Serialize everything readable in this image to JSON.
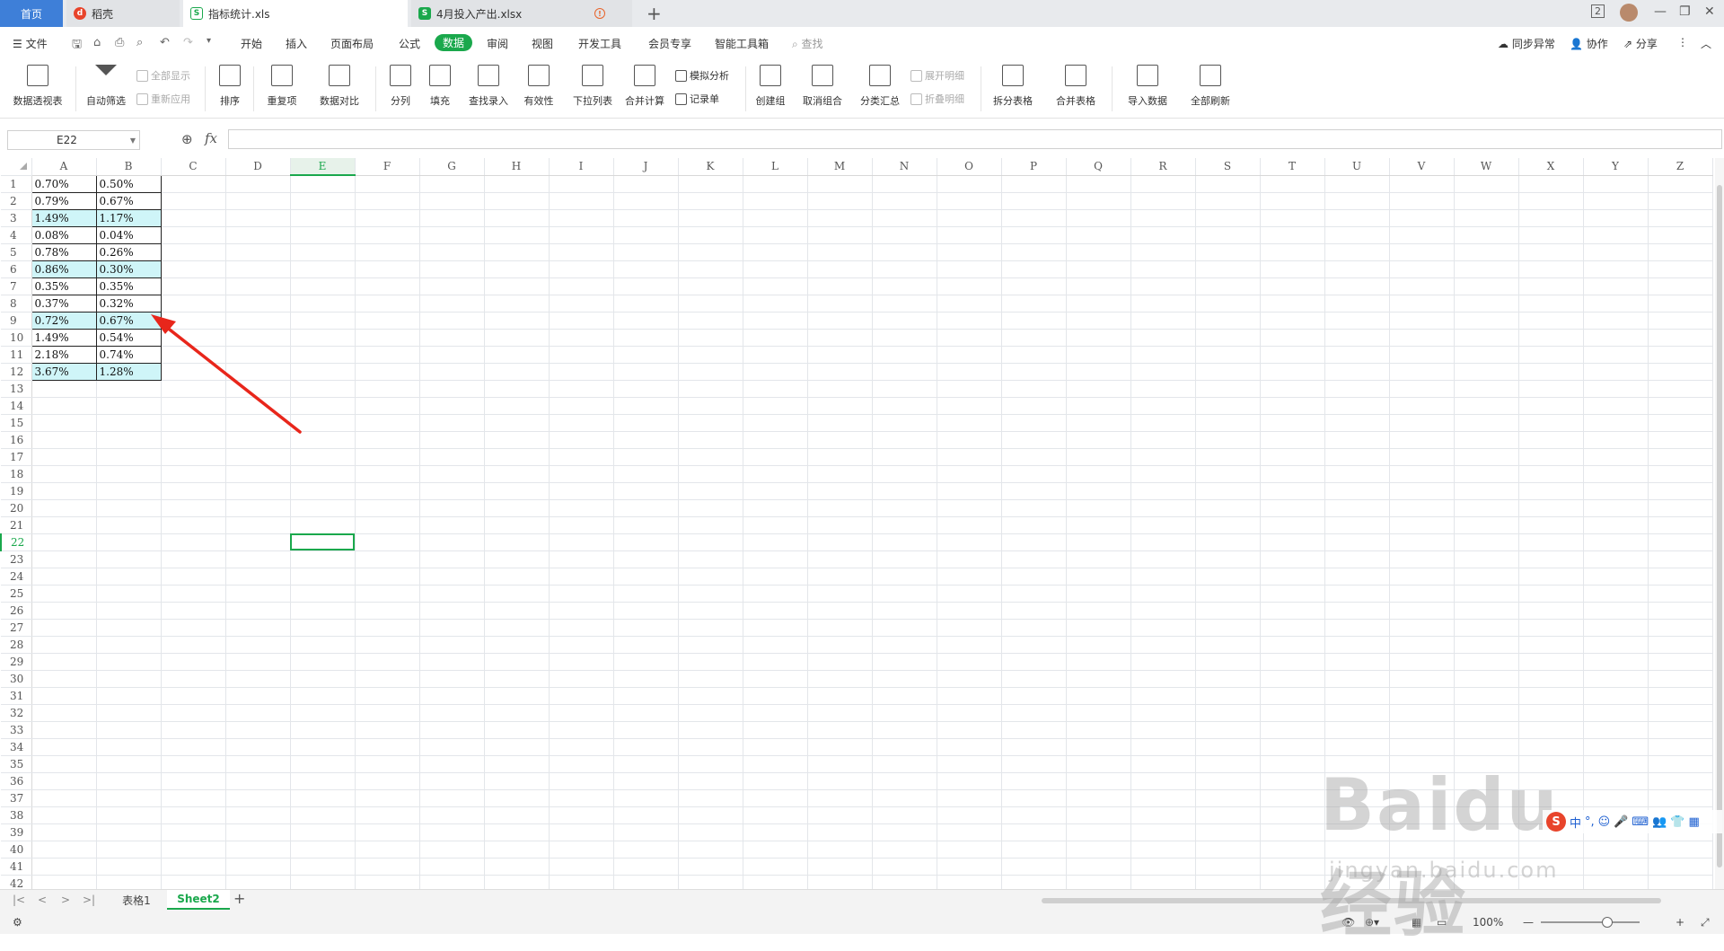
{
  "tabs": {
    "home": "首页",
    "daoke": "稻壳",
    "file1": "指标统计.xls",
    "file2": "4月投入产出.xlsx",
    "new_tab": "+",
    "doc_count": "2"
  },
  "menu": {
    "file": "文件",
    "items": [
      "开始",
      "插入",
      "页面布局",
      "公式",
      "数据",
      "审阅",
      "视图",
      "开发工具",
      "会员专享",
      "智能工具箱"
    ],
    "active": "数据",
    "search": "查找",
    "sync": "同步异常",
    "collab": "协作",
    "share": "分享"
  },
  "ribbon": {
    "pivot": "数据透视表",
    "autofilter": "自动筛选",
    "show_all": "全部显示",
    "reapply": "重新应用",
    "sort": "排序",
    "duplicates": "重复项",
    "compare": "数据对比",
    "split_col": "分列",
    "fill": "填充",
    "lookup_entry": "查找录入",
    "validity": "有效性",
    "dropdown_list": "下拉列表",
    "consolidate": "合并计算",
    "what_if": "模拟分析",
    "record_form": "记录单",
    "create_group": "创建组",
    "ungroup": "取消组合",
    "subtotal": "分类汇总",
    "expand_detail": "展开明细",
    "collapse_detail": "折叠明细",
    "split_table": "拆分表格",
    "merge_table": "合并表格",
    "import_data": "导入数据",
    "refresh_all": "全部刷新"
  },
  "formula_bar": {
    "name_box": "E22",
    "fx": "fx",
    "formula": ""
  },
  "grid": {
    "columns": [
      "A",
      "B",
      "C",
      "D",
      "E",
      "F",
      "G",
      "H",
      "I",
      "J",
      "K",
      "L",
      "M",
      "N",
      "O",
      "P",
      "Q",
      "R",
      "S",
      "T",
      "U",
      "V",
      "W",
      "X",
      "Y",
      "Z"
    ],
    "selected_column": "E",
    "selected_row": 22,
    "row_count": 42,
    "rows": [
      {
        "a": "0.70%",
        "b": "0.50%",
        "highlight": false
      },
      {
        "a": "0.79%",
        "b": "0.67%",
        "highlight": false
      },
      {
        "a": "1.49%",
        "b": "1.17%",
        "highlight": true
      },
      {
        "a": "0.08%",
        "b": "0.04%",
        "highlight": false
      },
      {
        "a": "0.78%",
        "b": "0.26%",
        "highlight": false
      },
      {
        "a": "0.86%",
        "b": "0.30%",
        "highlight": true
      },
      {
        "a": "0.35%",
        "b": "0.35%",
        "highlight": false
      },
      {
        "a": "0.37%",
        "b": "0.32%",
        "highlight": false
      },
      {
        "a": "0.72%",
        "b": "0.67%",
        "highlight": true
      },
      {
        "a": "1.49%",
        "b": "0.54%",
        "highlight": false
      },
      {
        "a": "2.18%",
        "b": "0.74%",
        "highlight": false
      },
      {
        "a": "3.67%",
        "b": "1.28%",
        "highlight": true
      }
    ]
  },
  "sheets": {
    "tabs": [
      "表格1",
      "Sheet2"
    ],
    "active": "Sheet2",
    "add": "+"
  },
  "status": {
    "zoom": "100%"
  },
  "ime": {
    "mode": "中"
  },
  "watermark": {
    "logo": "Baidu经验",
    "url": "jingyan.baidu.com"
  },
  "colors": {
    "accent": "#1aa84c",
    "highlight": "#cff5f8",
    "arrow": "#e8261b",
    "home_tab": "#3e7fd8"
  }
}
